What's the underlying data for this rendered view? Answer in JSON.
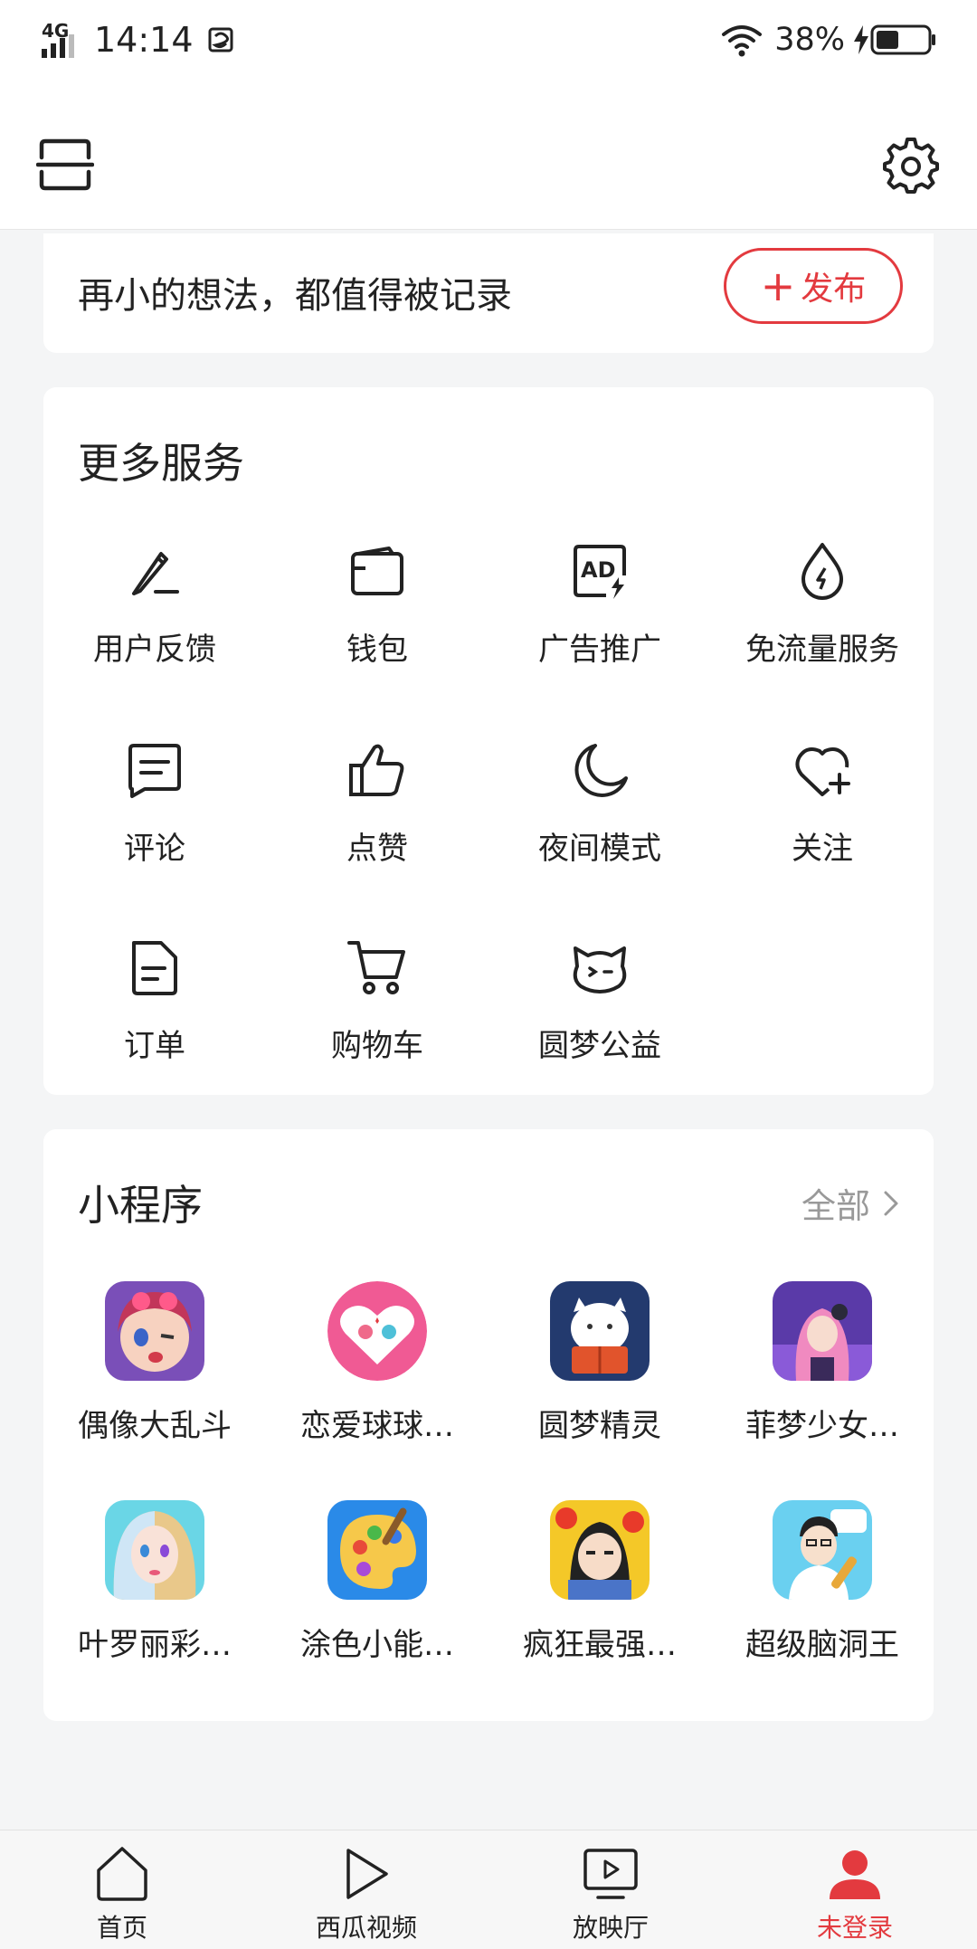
{
  "status_bar": {
    "network": "4G",
    "time": "14:14",
    "battery": "38%"
  },
  "post_prompt": {
    "text": "再小的想法，都值得被记录",
    "publish_label": "发布"
  },
  "more_services": {
    "title": "更多服务",
    "items": [
      {
        "label": "用户反馈",
        "icon": "pen-icon"
      },
      {
        "label": "钱包",
        "icon": "wallet-icon"
      },
      {
        "label": "广告推广",
        "icon": "ad-icon"
      },
      {
        "label": "免流量服务",
        "icon": "droplet-icon"
      },
      {
        "label": "评论",
        "icon": "comment-icon"
      },
      {
        "label": "点赞",
        "icon": "thumbs-up-icon"
      },
      {
        "label": "夜间模式",
        "icon": "moon-icon"
      },
      {
        "label": "关注",
        "icon": "heart-plus-icon"
      },
      {
        "label": "订单",
        "icon": "document-icon"
      },
      {
        "label": "购物车",
        "icon": "cart-icon"
      },
      {
        "label": "圆梦公益",
        "icon": "cat-face-icon"
      }
    ]
  },
  "mini_programs": {
    "title": "小程序",
    "view_all_label": "全部",
    "items": [
      {
        "label": "偶像大乱斗"
      },
      {
        "label": "恋爱球球…"
      },
      {
        "label": "圆梦精灵"
      },
      {
        "label": "菲梦少女…"
      },
      {
        "label": "叶罗丽彩…"
      },
      {
        "label": "涂色小能…"
      },
      {
        "label": "疯狂最强…"
      },
      {
        "label": "超级脑洞王"
      }
    ]
  },
  "tab_bar": {
    "tabs": [
      {
        "label": "首页"
      },
      {
        "label": "西瓜视频"
      },
      {
        "label": "放映厅"
      },
      {
        "label": "未登录"
      }
    ]
  },
  "colors": {
    "accent": "#e33a3f",
    "background": "#f4f5f6"
  }
}
